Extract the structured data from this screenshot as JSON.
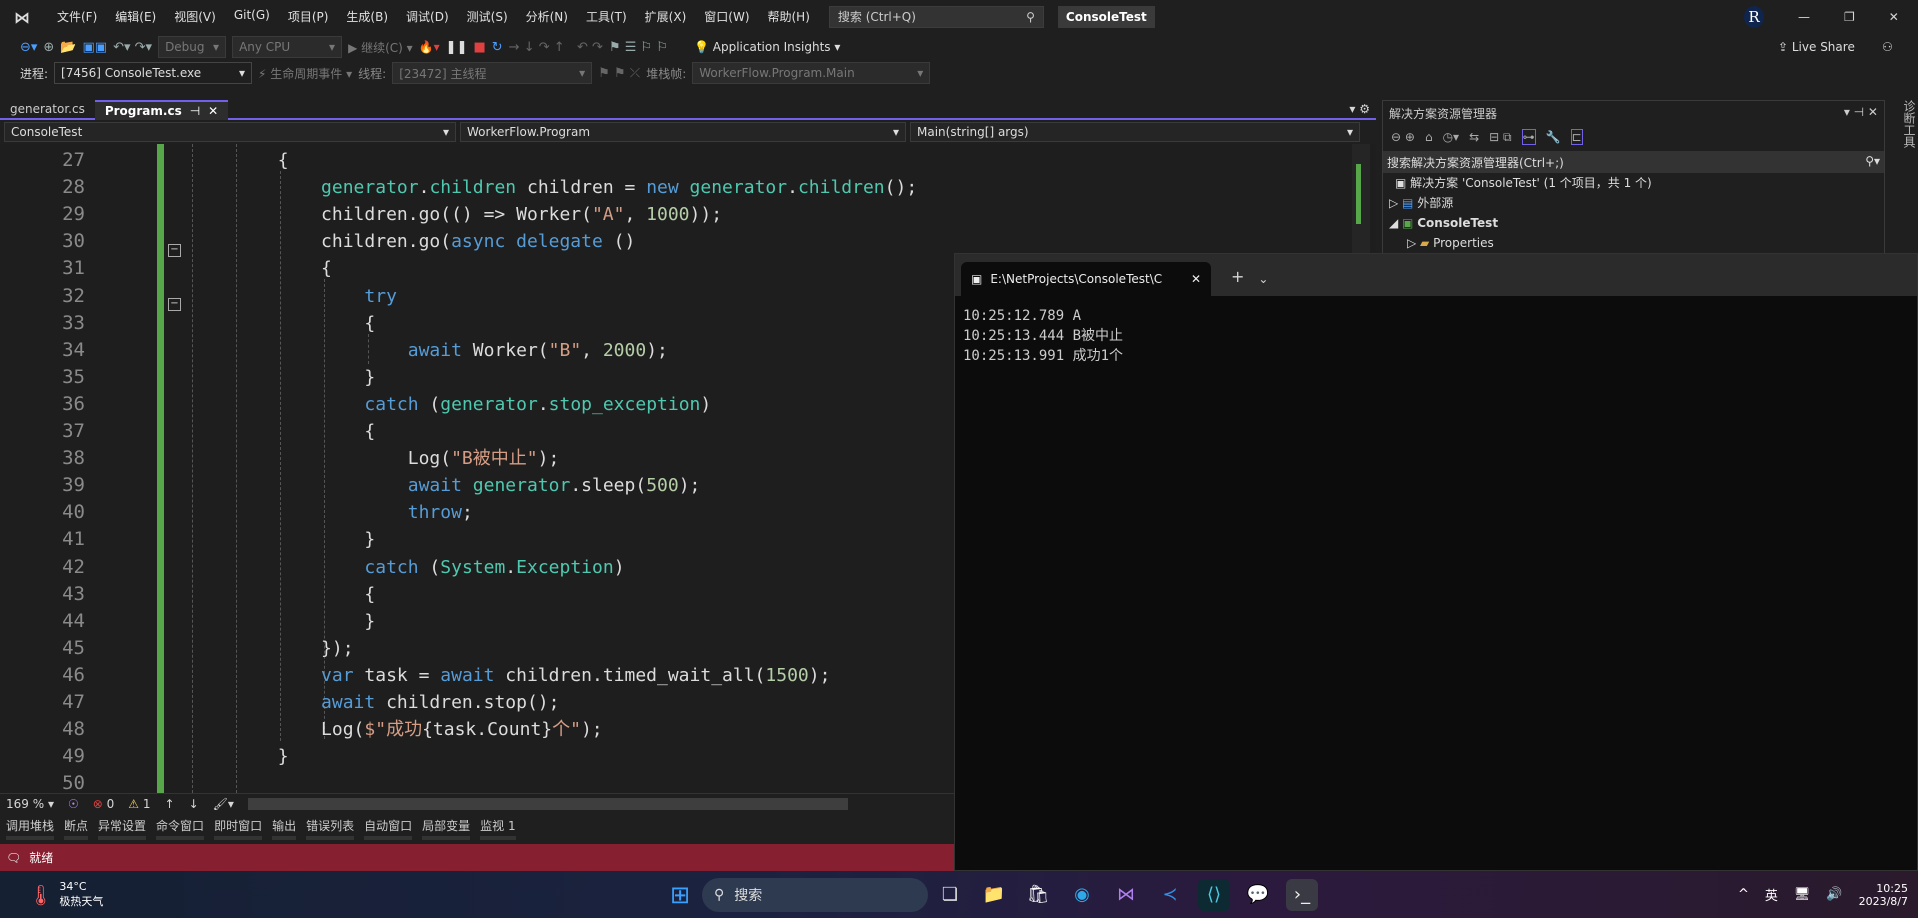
{
  "menu": {
    "items": [
      "文件(F)",
      "编辑(E)",
      "视图(V)",
      "Git(G)",
      "项目(P)",
      "生成(B)",
      "调试(D)",
      "测试(S)",
      "分析(N)",
      "工具(T)",
      "扩展(X)",
      "窗口(W)",
      "帮助(H)"
    ],
    "search_placeholder": "搜索 (Ctrl+Q)",
    "title": "ConsoleTest",
    "avatar": "R"
  },
  "toolbar1": {
    "config": "Debug",
    "platform": "Any CPU",
    "continue": "继续(C)",
    "insights": "Application Insights",
    "live_share": "Live Share"
  },
  "toolbar2": {
    "process_label": "进程:",
    "process": "[7456] ConsoleTest.exe",
    "lifecycle": "生命周期事件",
    "thread_label": "线程:",
    "thread": "[23472] 主线程",
    "stack_label": "堆栈帧:",
    "stack": "WorkerFlow.Program.Main"
  },
  "tabs": [
    {
      "label": "generator.cs"
    },
    {
      "label": "Program.cs"
    }
  ],
  "navbar": {
    "project": "ConsoleTest",
    "class": "WorkerFlow.Program",
    "member": "Main(string[] args)"
  },
  "code": [
    {
      "n": "27",
      "t": [
        [
          "        {",
          ""
        ]
      ]
    },
    {
      "n": "28",
      "t": [
        [
          "            ",
          ""
        ],
        [
          "generator",
          "ty"
        ],
        [
          ".",
          ""
        ],
        [
          "children",
          "ty"
        ],
        [
          " children = ",
          ""
        ],
        [
          "new",
          "kw"
        ],
        [
          " ",
          ""
        ],
        [
          "generator",
          "ty"
        ],
        [
          ".",
          ""
        ],
        [
          "children",
          "ty"
        ],
        [
          "();",
          ""
        ]
      ]
    },
    {
      "n": "29",
      "t": [
        [
          "            children.go(() => Worker(",
          ""
        ],
        [
          "\"A\"",
          "st"
        ],
        [
          ", ",
          ""
        ],
        [
          "1000",
          "nu"
        ],
        [
          "));",
          ""
        ]
      ]
    },
    {
      "n": "30",
      "t": [
        [
          "            children.go(",
          ""
        ],
        [
          "async",
          "kw"
        ],
        [
          " ",
          ""
        ],
        [
          "delegate",
          "kw"
        ],
        [
          " ()",
          ""
        ]
      ]
    },
    {
      "n": "31",
      "t": [
        [
          "            {",
          ""
        ]
      ]
    },
    {
      "n": "32",
      "t": [
        [
          "                ",
          ""
        ],
        [
          "try",
          "kw"
        ]
      ]
    },
    {
      "n": "33",
      "t": [
        [
          "                {",
          ""
        ]
      ]
    },
    {
      "n": "34",
      "t": [
        [
          "                    ",
          ""
        ],
        [
          "await",
          "kw"
        ],
        [
          " Worker(",
          ""
        ],
        [
          "\"B\"",
          "st"
        ],
        [
          ", ",
          ""
        ],
        [
          "2000",
          "nu"
        ],
        [
          ");",
          ""
        ]
      ]
    },
    {
      "n": "35",
      "t": [
        [
          "                }",
          ""
        ]
      ]
    },
    {
      "n": "36",
      "t": [
        [
          "                ",
          ""
        ],
        [
          "catch",
          "kw"
        ],
        [
          " (",
          ""
        ],
        [
          "generator",
          "ty"
        ],
        [
          ".",
          ""
        ],
        [
          "stop_exception",
          "ty"
        ],
        [
          ")",
          ""
        ]
      ]
    },
    {
      "n": "37",
      "t": [
        [
          "                {",
          ""
        ]
      ]
    },
    {
      "n": "38",
      "t": [
        [
          "                    Log(",
          ""
        ],
        [
          "\"B被中止\"",
          "st"
        ],
        [
          ");",
          ""
        ]
      ]
    },
    {
      "n": "39",
      "t": [
        [
          "                    ",
          ""
        ],
        [
          "await",
          "kw"
        ],
        [
          " ",
          ""
        ],
        [
          "generator",
          "ty"
        ],
        [
          ".sleep(",
          ""
        ],
        [
          "500",
          "nu"
        ],
        [
          ");",
          ""
        ]
      ]
    },
    {
      "n": "40",
      "t": [
        [
          "                    ",
          ""
        ],
        [
          "throw",
          "kw"
        ],
        [
          ";",
          ""
        ]
      ]
    },
    {
      "n": "41",
      "t": [
        [
          "                }",
          ""
        ]
      ]
    },
    {
      "n": "42",
      "t": [
        [
          "                ",
          ""
        ],
        [
          "catch",
          "kw"
        ],
        [
          " (",
          ""
        ],
        [
          "System",
          "ty"
        ],
        [
          ".",
          ""
        ],
        [
          "Exception",
          "ty"
        ],
        [
          ")",
          ""
        ]
      ]
    },
    {
      "n": "43",
      "t": [
        [
          "                {",
          ""
        ]
      ]
    },
    {
      "n": "44",
      "t": [
        [
          "                }",
          ""
        ]
      ]
    },
    {
      "n": "45",
      "t": [
        [
          "            });",
          ""
        ]
      ]
    },
    {
      "n": "46",
      "t": [
        [
          "            ",
          ""
        ],
        [
          "var",
          "kw"
        ],
        [
          " task = ",
          ""
        ],
        [
          "await",
          "kw"
        ],
        [
          " children.timed_wait_all(",
          ""
        ],
        [
          "1500",
          "nu"
        ],
        [
          ");",
          ""
        ]
      ]
    },
    {
      "n": "47",
      "t": [
        [
          "            ",
          ""
        ],
        [
          "await",
          "kw"
        ],
        [
          " children.stop();",
          ""
        ]
      ]
    },
    {
      "n": "48",
      "t": [
        [
          "            Log(",
          ""
        ],
        [
          "$\"成功",
          "st"
        ],
        [
          "{task.Count}",
          ""
        ],
        [
          "个\"",
          "st"
        ],
        [
          ");",
          ""
        ]
      ]
    },
    {
      "n": "49",
      "t": [
        [
          "        }",
          ""
        ]
      ]
    },
    {
      "n": "50",
      "t": [
        [
          "",
          ""
        ]
      ]
    }
  ],
  "status": {
    "zoom": "169 %",
    "errors": "0",
    "warnings": "1"
  },
  "bottom_tabs": [
    "调用堆栈",
    "断点",
    "异常设置",
    "命令窗口",
    "即时窗口",
    "输出",
    "错误列表",
    "自动窗口",
    "局部变量",
    "监视 1"
  ],
  "statusbar": {
    "text": "就绪",
    "color": "#862030"
  },
  "solution_explorer": {
    "title": "解决方案资源管理器",
    "search": "搜索解决方案资源管理器(Ctrl+;)",
    "items": [
      "解决方案 'ConsoleTest' (1 个项目，共 1 个)",
      "外部源",
      "ConsoleTest",
      "Properties"
    ]
  },
  "right_strip": "诊断工具",
  "console": {
    "tab_title": "E:\\NetProjects\\ConsoleTest\\C",
    "lines": [
      "10:25:12.789 A",
      "10:25:13.444 B被中止",
      "10:25:13.991 成功1个"
    ]
  },
  "taskbar": {
    "temp": "34°C",
    "weather": "极热天气",
    "search": "搜索",
    "ime": "英",
    "time": "10:25",
    "date": "2023/8/7"
  }
}
